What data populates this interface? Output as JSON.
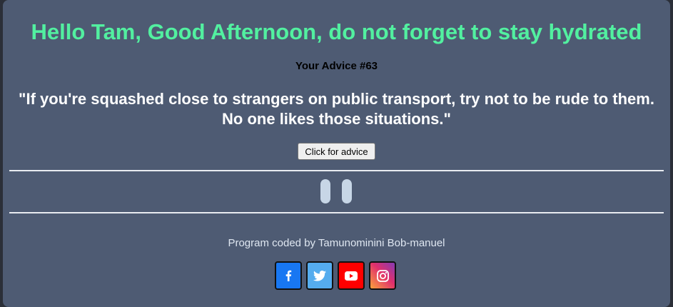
{
  "greeting": "Hello Tam, Good Afternoon, do not forget to stay hydrated",
  "advice": {
    "number_label": "Your Advice #63",
    "quote": "\"If you're squashed close to strangers on public transport, try not to be rude to them. No one likes those situations.\"",
    "button_label": "Click for advice"
  },
  "player": {
    "control_icon": "pause-icon"
  },
  "footer": {
    "credit": "Program coded by Tamunominini Bob-manuel",
    "socials": [
      {
        "name": "facebook",
        "icon": "facebook-icon",
        "color": "#1877f2"
      },
      {
        "name": "twitter",
        "icon": "twitter-icon",
        "color": "#55acee"
      },
      {
        "name": "youtube",
        "icon": "youtube-icon",
        "color": "#ff0000"
      },
      {
        "name": "instagram",
        "icon": "instagram-icon",
        "color": "#d6249f"
      }
    ]
  },
  "colors": {
    "background": "#4e5b73",
    "greeting": "#52f0a0",
    "quote": "#ffffff"
  }
}
